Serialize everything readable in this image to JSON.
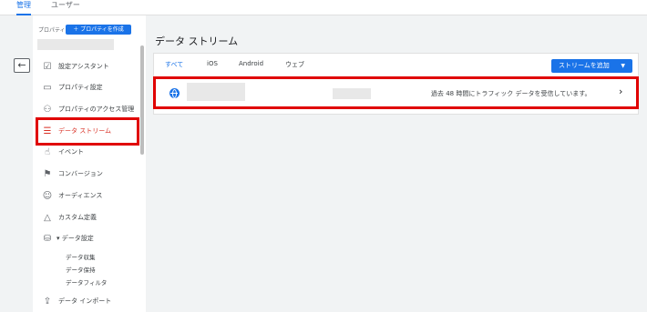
{
  "top_tabs": [
    {
      "label": "管理"
    },
    {
      "label": "ユーザー"
    }
  ],
  "sidebar": {
    "property_label": "プロパティ",
    "create_button": "＋ プロパティを作成",
    "items": [
      {
        "label": "設定アシスタント",
        "icon": "checkbox-icon"
      },
      {
        "label": "プロパティ設定",
        "icon": "property-settings-icon"
      },
      {
        "label": "プロパティのアクセス管理",
        "icon": "people-icon"
      },
      {
        "label": "データ ストリーム",
        "icon": "data-stream-icon"
      },
      {
        "label": "イベント",
        "icon": "touch-icon"
      },
      {
        "label": "コンバージョン",
        "icon": "flag-icon"
      },
      {
        "label": "オーディエンス",
        "icon": "audience-icon"
      },
      {
        "label": "カスタム定義",
        "icon": "shapes-icon"
      },
      {
        "label": "データ設定",
        "icon": "database-icon"
      },
      {
        "label": "データ インポート",
        "icon": "upload-icon"
      }
    ],
    "subitems": [
      {
        "label": "データ収集"
      },
      {
        "label": "データ保持"
      },
      {
        "label": "データフィルタ"
      }
    ]
  },
  "main": {
    "title": "データ ストリーム",
    "tabs": [
      {
        "label": "すべて"
      },
      {
        "label": "iOS"
      },
      {
        "label": "Android"
      },
      {
        "label": "ウェブ"
      }
    ],
    "add_button": "ストリームを追加",
    "stream": {
      "status": "過去 48 時間にトラフィック データを受信しています。"
    }
  },
  "colors": {
    "accent": "#1a73e8",
    "highlight": "#e00000",
    "active_text": "#d93025"
  }
}
